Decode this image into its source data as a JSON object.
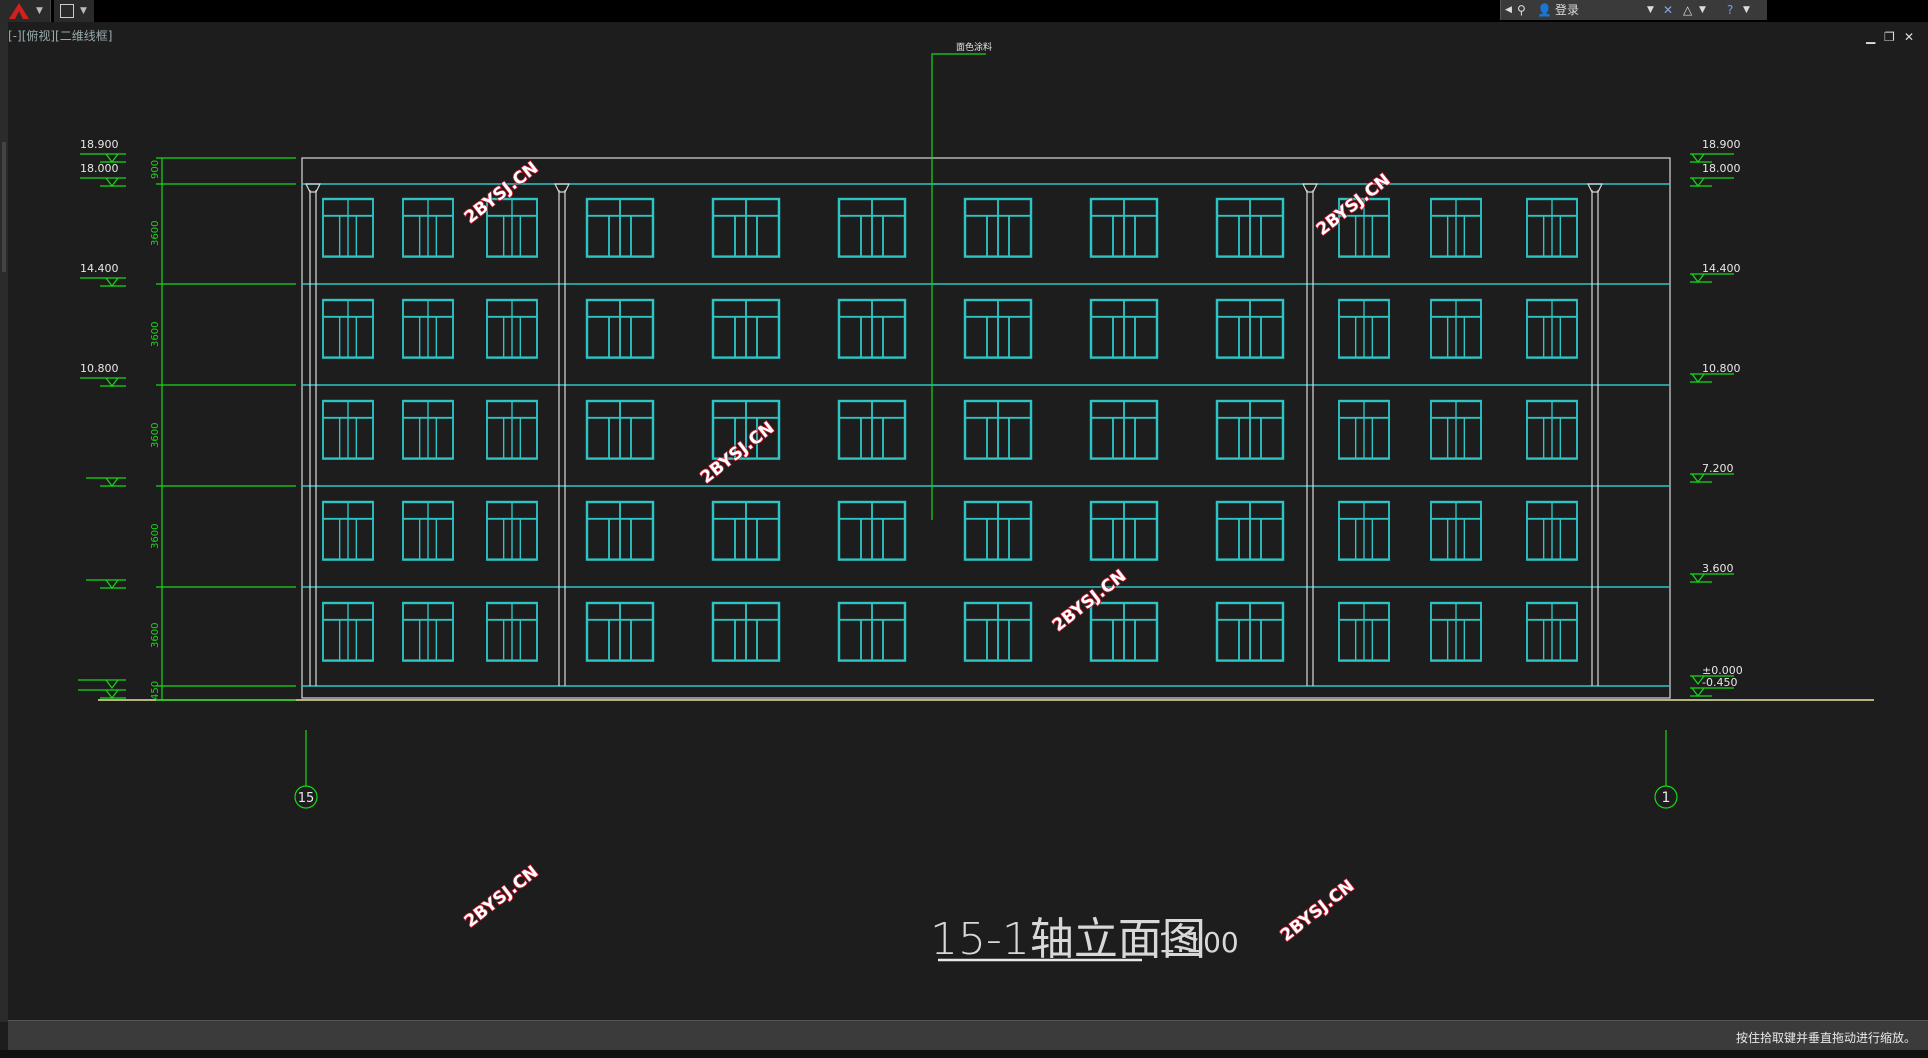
{
  "app": {
    "viewport_label": "[-][俯视][二维线框]",
    "login_label": "登录",
    "status_message": "按住拾取键并垂直拖动进行缩放。"
  },
  "drawing": {
    "title": "15-1轴立面图",
    "scale": "1:100",
    "watermark": "2BYSJ.CN",
    "leader_note": "面色涂料",
    "axis_left": "15",
    "axis_right": "1",
    "elevations_left": [
      "18.900",
      "18.000",
      "14.400",
      "10.800"
    ],
    "elevations_right": [
      "18.900",
      "18.000",
      "14.400",
      "10.800",
      "7.200",
      "3.600",
      "±0.000",
      "-0.450"
    ],
    "dims": [
      "900",
      "3600",
      "3600",
      "3600",
      "3600",
      "3600",
      "450"
    ]
  },
  "colors": {
    "line_cyan": "#2ec4c4",
    "line_green": "#16d916",
    "line_white": "#d8d8d8",
    "line_yellow": "#e6e6a0",
    "watermark_red": "#d4142a"
  },
  "icons": [
    "autocad-logo-icon",
    "save-icon",
    "binoculars-icon",
    "user-icon",
    "exchange-icon",
    "a360-icon",
    "help-icon",
    "minimize-icon",
    "restore-icon",
    "close-icon"
  ]
}
